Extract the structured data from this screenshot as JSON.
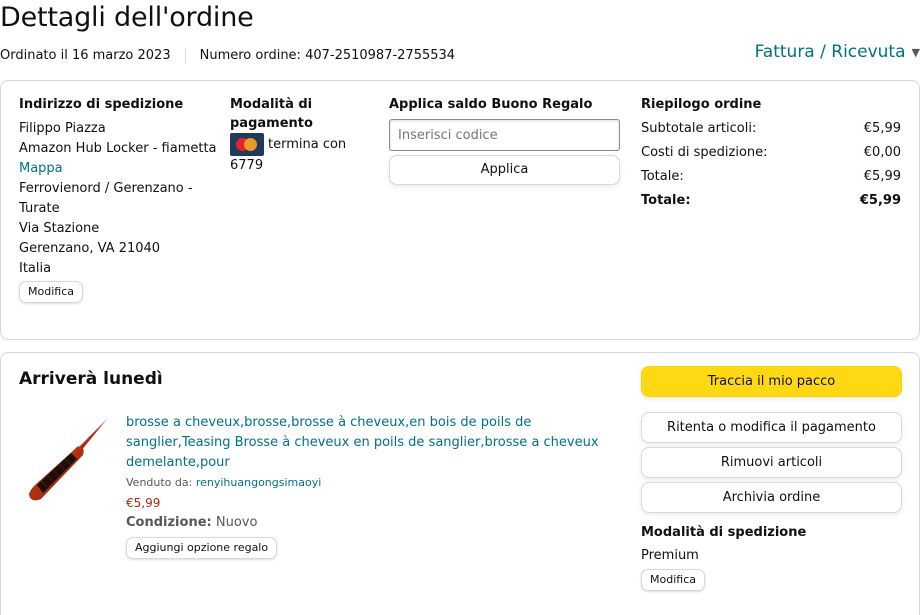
{
  "page": {
    "title": "Dettagli dell'ordine",
    "ordered_on": "Ordinato il 16 marzo 2023",
    "order_number": "Numero ordine: 407-2510987-2755534",
    "invoice_label": "Fattura / Ricevuta",
    "invoice_icon": "chevron-down-icon"
  },
  "shipping_address": {
    "heading": "Indirizzo di spedizione",
    "name": "Filippo Piazza",
    "line1": "Amazon Hub Locker - fiametta",
    "map_link": "Mappa",
    "line2": "Ferrovienord / Gerenzano - Turate",
    "line3": "Via Stazione",
    "line4": "Gerenzano, VA 21040",
    "country": "Italia",
    "edit_label": "Modifica"
  },
  "payment": {
    "heading": "Modalità di pagamento",
    "card_icon": "mastercard-icon",
    "card_text": "termina con 6779"
  },
  "gift_card": {
    "heading": "Applica saldo Buono Regalo",
    "placeholder": "Inserisci codice",
    "apply_label": "Applica"
  },
  "summary": {
    "heading": "Riepilogo ordine",
    "rows": [
      {
        "label": "Subtotale articoli:",
        "value": "€5,99"
      },
      {
        "label": "Costi di spedizione:",
        "value": "€0,00"
      },
      {
        "label": "Totale:",
        "value": "€5,99"
      },
      {
        "label": "Totale:",
        "value": "€5,99"
      }
    ]
  },
  "shipment": {
    "arrival": "Arriverà lunedì",
    "product_title": "brosse a cheveux,brosse,brosse à cheveux,en bois de poils de sanglier,Teasing Brosse à cheveux en poils de sanglier,brosse a cheveux demelante,pour",
    "sold_by_label": "Venduto da:",
    "seller": "renyihuangongsimaoyi",
    "price": "€5,99",
    "condition_label": "Condizione:",
    "condition_value": "Nuovo",
    "gift_option_label": "Aggiungi opzione regalo",
    "track_label": "Traccia il mio pacco",
    "retry_payment_label": "Ritenta o modifica il pagamento",
    "remove_items_label": "Rimuovi articoli",
    "archive_label": "Archivia ordine",
    "shipping_method_heading": "Modalità di spedizione",
    "shipping_method_value": "Premium",
    "shipping_edit_label": "Modifica"
  },
  "colors": {
    "link": "#007185",
    "price": "#b12704",
    "primary_button": "#ffd814"
  }
}
